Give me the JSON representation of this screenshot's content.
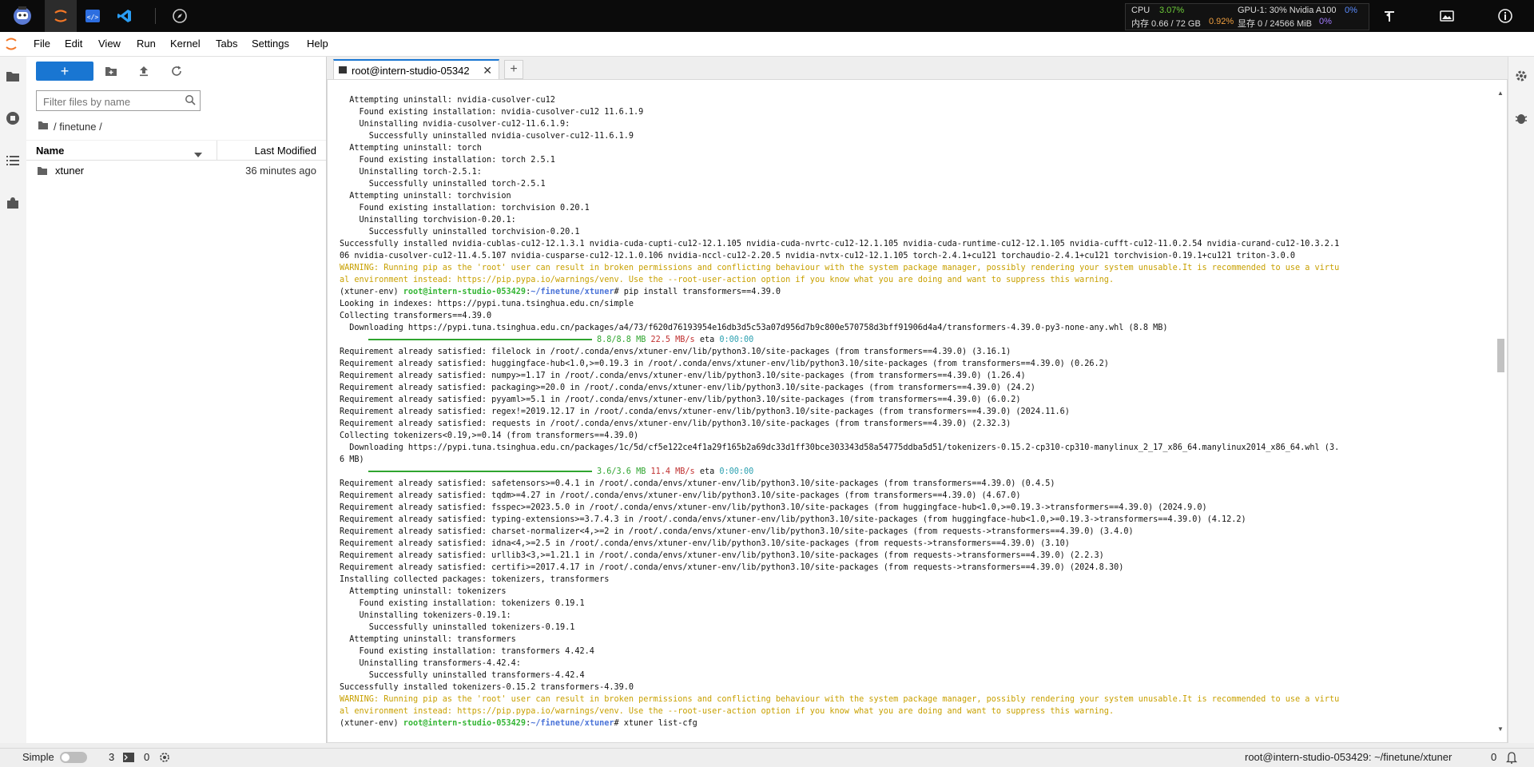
{
  "topbar": {
    "stats": {
      "cpu_label": "CPU",
      "cpu_value": "3.07%",
      "mem_label": "内存 0.66 / 72 GB",
      "mem_value": "0.92%",
      "gpu_label": "GPU-1: 30% Nvidia A100",
      "gpu_value": "0%",
      "vram_label": "显存 0 / 24566 MiB",
      "vram_value": "0%"
    }
  },
  "menu": [
    "File",
    "Edit",
    "View",
    "Run",
    "Kernel",
    "Tabs",
    "Settings",
    "Help"
  ],
  "filebrowser": {
    "new_label": "+",
    "filter_placeholder": "Filter files by name",
    "breadcrumb": "/ finetune /",
    "col_name": "Name",
    "col_modified": "Last Modified",
    "files": [
      {
        "name": "xtuner",
        "modified": "36 minutes ago"
      }
    ]
  },
  "tab": {
    "label": "root@intern-studio-05342",
    "close": "✕",
    "add": "+"
  },
  "terminal": {
    "lines": [
      "  Attempting uninstall: nvidia-cusolver-cu12",
      "    Found existing installation: nvidia-cusolver-cu12 11.6.1.9",
      "    Uninstalling nvidia-cusolver-cu12-11.6.1.9:",
      "      Successfully uninstalled nvidia-cusolver-cu12-11.6.1.9",
      "  Attempting uninstall: torch",
      "    Found existing installation: torch 2.5.1",
      "    Uninstalling torch-2.5.1:",
      "      Successfully uninstalled torch-2.5.1",
      "  Attempting uninstall: torchvision",
      "    Found existing installation: torchvision 0.20.1",
      "    Uninstalling torchvision-0.20.1:",
      "      Successfully uninstalled torchvision-0.20.1",
      "Successfully installed nvidia-cublas-cu12-12.1.3.1 nvidia-cuda-cupti-cu12-12.1.105 nvidia-cuda-nvrtc-cu12-12.1.105 nvidia-cuda-runtime-cu12-12.1.105 nvidia-cufft-cu12-11.0.2.54 nvidia-curand-cu12-10.3.2.1",
      "06 nvidia-cusolver-cu12-11.4.5.107 nvidia-cusparse-cu12-12.1.0.106 nvidia-nccl-cu12-2.20.5 nvidia-nvtx-cu12-12.1.105 torch-2.4.1+cu121 torchaudio-2.4.1+cu121 torchvision-0.19.1+cu121 triton-3.0.0"
    ],
    "warning1a": "WARNING: Running pip as the 'root' user can result in broken permissions and conflicting behaviour with the system package manager, possibly rendering your system unusable.It is recommended to use a virtu",
    "warning1b": "al environment instead: https://pip.pypa.io/warnings/venv. Use the --root-user-action option if you know what you are doing and want to suppress this warning.",
    "prompt_env": "(xtuner-env) ",
    "prompt_user": "root@intern-studio-053429",
    "prompt_colon": ":",
    "prompt_path": "~/finetune/xtuner",
    "prompt_hash": "# ",
    "cmd1": "pip install transformers==4.39.0",
    "lines2": [
      "Looking in indexes: https://pypi.tuna.tsinghua.edu.cn/simple",
      "Collecting transformers==4.39.0",
      "  Downloading https://pypi.tuna.tsinghua.edu.cn/packages/a4/73/f620d76193954e16db3d5c53a07d956d7b9c800e570758d3bff91906d4a4/transformers-4.39.0-py3-none-any.whl (8.8 MB)"
    ],
    "progress1": {
      "size": "8.8/8.8 MB",
      "speed": "22.5 MB/s",
      "eta_label": "eta",
      "eta": "0:00:00"
    },
    "lines3": [
      "Requirement already satisfied: filelock in /root/.conda/envs/xtuner-env/lib/python3.10/site-packages (from transformers==4.39.0) (3.16.1)",
      "Requirement already satisfied: huggingface-hub<1.0,>=0.19.3 in /root/.conda/envs/xtuner-env/lib/python3.10/site-packages (from transformers==4.39.0) (0.26.2)",
      "Requirement already satisfied: numpy>=1.17 in /root/.conda/envs/xtuner-env/lib/python3.10/site-packages (from transformers==4.39.0) (1.26.4)",
      "Requirement already satisfied: packaging>=20.0 in /root/.conda/envs/xtuner-env/lib/python3.10/site-packages (from transformers==4.39.0) (24.2)",
      "Requirement already satisfied: pyyaml>=5.1 in /root/.conda/envs/xtuner-env/lib/python3.10/site-packages (from transformers==4.39.0) (6.0.2)",
      "Requirement already satisfied: regex!=2019.12.17 in /root/.conda/envs/xtuner-env/lib/python3.10/site-packages (from transformers==4.39.0) (2024.11.6)",
      "Requirement already satisfied: requests in /root/.conda/envs/xtuner-env/lib/python3.10/site-packages (from transformers==4.39.0) (2.32.3)",
      "Collecting tokenizers<0.19,>=0.14 (from transformers==4.39.0)",
      "  Downloading https://pypi.tuna.tsinghua.edu.cn/packages/1c/5d/cf5e122ce4f1a29f165b2a69dc33d1ff30bce303343d58a54775ddba5d51/tokenizers-0.15.2-cp310-cp310-manylinux_2_17_x86_64.manylinux2014_x86_64.whl (3.",
      "6 MB)"
    ],
    "progress2": {
      "size": "3.6/3.6 MB",
      "speed": "11.4 MB/s",
      "eta_label": "eta",
      "eta": "0:00:00"
    },
    "lines4": [
      "Requirement already satisfied: safetensors>=0.4.1 in /root/.conda/envs/xtuner-env/lib/python3.10/site-packages (from transformers==4.39.0) (0.4.5)",
      "Requirement already satisfied: tqdm>=4.27 in /root/.conda/envs/xtuner-env/lib/python3.10/site-packages (from transformers==4.39.0) (4.67.0)",
      "Requirement already satisfied: fsspec>=2023.5.0 in /root/.conda/envs/xtuner-env/lib/python3.10/site-packages (from huggingface-hub<1.0,>=0.19.3->transformers==4.39.0) (2024.9.0)",
      "Requirement already satisfied: typing-extensions>=3.7.4.3 in /root/.conda/envs/xtuner-env/lib/python3.10/site-packages (from huggingface-hub<1.0,>=0.19.3->transformers==4.39.0) (4.12.2)",
      "Requirement already satisfied: charset-normalizer<4,>=2 in /root/.conda/envs/xtuner-env/lib/python3.10/site-packages (from requests->transformers==4.39.0) (3.4.0)",
      "Requirement already satisfied: idna<4,>=2.5 in /root/.conda/envs/xtuner-env/lib/python3.10/site-packages (from requests->transformers==4.39.0) (3.10)",
      "Requirement already satisfied: urllib3<3,>=1.21.1 in /root/.conda/envs/xtuner-env/lib/python3.10/site-packages (from requests->transformers==4.39.0) (2.2.3)",
      "Requirement already satisfied: certifi>=2017.4.17 in /root/.conda/envs/xtuner-env/lib/python3.10/site-packages (from requests->transformers==4.39.0) (2024.8.30)",
      "Installing collected packages: tokenizers, transformers",
      "  Attempting uninstall: tokenizers",
      "    Found existing installation: tokenizers 0.19.1",
      "    Uninstalling tokenizers-0.19.1:",
      "      Successfully uninstalled tokenizers-0.19.1",
      "  Attempting uninstall: transformers",
      "    Found existing installation: transformers 4.42.4",
      "    Uninstalling transformers-4.42.4:",
      "      Successfully uninstalled transformers-4.42.4",
      "Successfully installed tokenizers-0.15.2 transformers-4.39.0"
    ],
    "warning2a": "WARNING: Running pip as the 'root' user can result in broken permissions and conflicting behaviour with the system package manager, possibly rendering your system unusable.It is recommended to use a virtu",
    "warning2b": "al environment instead: https://pip.pypa.io/warnings/venv. Use the --root-user-action option if you know what you are doing and want to suppress this warning.",
    "cmd2": "xtuner list-cfg"
  },
  "statusbar": {
    "mode": "Simple",
    "count1": "3",
    "count2": "0",
    "path": "root@intern-studio-053429: ~/finetune/xtuner",
    "notifications": "0"
  },
  "colors": {
    "accent": "#1976d2",
    "warning": "#c8a000",
    "prompt_user": "#34b534",
    "prompt_path": "#4a73d8",
    "progress": "#2fa52f"
  }
}
